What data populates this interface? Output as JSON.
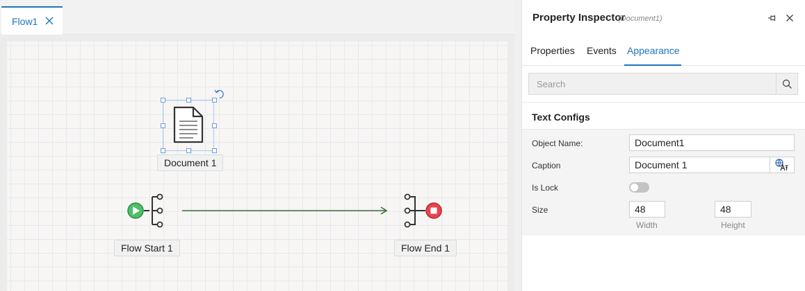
{
  "editor": {
    "tab": {
      "label": "Flow1"
    },
    "nodes": {
      "document": {
        "label": "Document 1"
      },
      "flow_start": {
        "label": "Flow Start 1"
      },
      "flow_end": {
        "label": "Flow End 1"
      }
    }
  },
  "inspector": {
    "title": "Property Inspector",
    "subtitle": "(Document1)",
    "tabs": [
      "Properties",
      "Events",
      "Appearance"
    ],
    "active_tab": "Appearance",
    "search": {
      "placeholder": "Search",
      "value": ""
    },
    "section": {
      "title": "Text Configs",
      "object_name": {
        "label": "Object Name:",
        "value": "Document1"
      },
      "caption": {
        "label": "Caption",
        "value": "Document 1"
      },
      "is_lock": {
        "label": "Is Lock",
        "value": false
      },
      "size": {
        "label": "Size",
        "width": "48",
        "height": "48",
        "width_label": "Width",
        "height_label": "Height"
      }
    }
  },
  "colors": {
    "accent": "#1e73be",
    "start_green": "#4cc165",
    "end_red": "#e8444c",
    "connector": "#3f6b3a"
  },
  "icons": [
    "close-icon",
    "document-icon",
    "rotate-icon",
    "flow-start-icon",
    "flow-end-icon",
    "arrow-connector",
    "pin-icon",
    "search-icon",
    "translate-icon"
  ]
}
